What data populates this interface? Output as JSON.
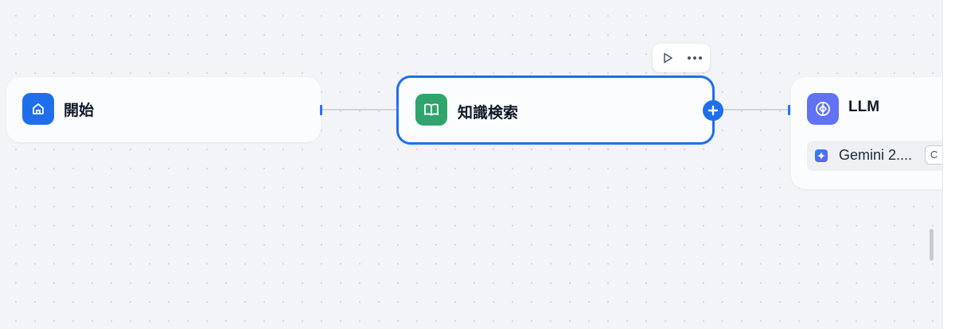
{
  "nodes": {
    "start": {
      "title": "開始",
      "icon": "home-icon",
      "accent": "#1f6feb"
    },
    "knowledge": {
      "title": "知識検索",
      "icon": "book-open-icon",
      "accent": "#30a46c"
    },
    "llm": {
      "title": "LLM",
      "icon": "brain-icon",
      "accent": "#6172f3",
      "model": {
        "name": "Gemini 2....",
        "badge": "C"
      }
    }
  },
  "toolbar": {
    "run_icon": "play-icon",
    "more_icon": "more-horizontal-icon"
  },
  "add_icon": "plus-icon",
  "colors": {
    "selection": "#1f6feb",
    "edge": "#d0d5dd",
    "handle": "#2970ff"
  }
}
